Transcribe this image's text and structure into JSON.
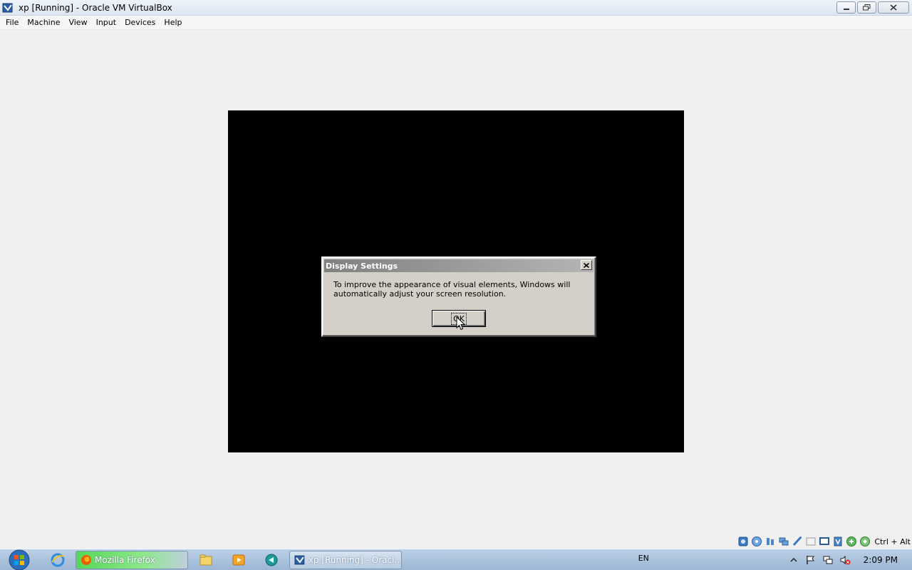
{
  "window": {
    "title": "xp [Running] - Oracle VM VirtualBox"
  },
  "menubar": {
    "items": [
      "File",
      "Machine",
      "View",
      "Input",
      "Devices",
      "Help"
    ]
  },
  "dialog": {
    "title": "Display Settings",
    "message": "To improve the appearance of visual elements, Windows will automatically adjust your screen resolution.",
    "ok_label": "OK"
  },
  "vm_status": {
    "host_key": "Ctrl + Alt"
  },
  "taskbar": {
    "tasks": [
      {
        "label": "Mozilla Firefox"
      },
      {
        "label": "xp [Running] - Oracl..."
      }
    ],
    "language": "EN",
    "clock": "2:09 PM"
  },
  "colors": {
    "vm_background": "#000000",
    "dialog_face": "#d4d0c8",
    "dialog_title_inactive": "#808080"
  }
}
